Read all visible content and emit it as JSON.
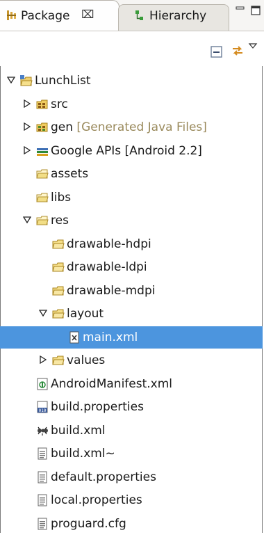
{
  "tabs": [
    {
      "label": "Package",
      "close": "⌧",
      "active": true
    },
    {
      "label": "Hierarchy",
      "active": false
    }
  ],
  "toolbar": {
    "collapse_icon": "collapse-all-icon",
    "link_icon": "link-with-editor-icon",
    "menu_icon": "view-menu-icon"
  },
  "tree": [
    {
      "label": "LunchList",
      "decoration": "",
      "indent": 0,
      "twisty": "expanded",
      "icon": "android-project-icon"
    },
    {
      "label": "src",
      "decoration": "",
      "indent": 1,
      "twisty": "collapsed",
      "icon": "source-folder-icon"
    },
    {
      "label": "gen",
      "decoration": " [Generated Java Files]",
      "indent": 1,
      "twisty": "collapsed",
      "icon": "gen-folder-icon"
    },
    {
      "label": "Google APIs [Android 2.2]",
      "decoration": "",
      "indent": 1,
      "twisty": "collapsed",
      "icon": "library-icon"
    },
    {
      "label": "assets",
      "decoration": "",
      "indent": 1,
      "twisty": "none",
      "icon": "project-folder-icon"
    },
    {
      "label": "libs",
      "decoration": "",
      "indent": 1,
      "twisty": "none",
      "icon": "project-folder-icon"
    },
    {
      "label": "res",
      "decoration": "",
      "indent": 1,
      "twisty": "expanded",
      "icon": "project-folder-icon"
    },
    {
      "label": "drawable-hdpi",
      "decoration": "",
      "indent": 2,
      "twisty": "none",
      "icon": "folder-icon"
    },
    {
      "label": "drawable-ldpi",
      "decoration": "",
      "indent": 2,
      "twisty": "none",
      "icon": "folder-icon"
    },
    {
      "label": "drawable-mdpi",
      "decoration": "",
      "indent": 2,
      "twisty": "none",
      "icon": "folder-icon"
    },
    {
      "label": "layout",
      "decoration": "",
      "indent": 2,
      "twisty": "expanded",
      "icon": "folder-icon"
    },
    {
      "label": "main.xml",
      "decoration": "",
      "indent": 3,
      "twisty": "none",
      "icon": "xml-file-icon",
      "selected": true
    },
    {
      "label": "values",
      "decoration": "",
      "indent": 2,
      "twisty": "collapsed",
      "icon": "folder-icon"
    },
    {
      "label": "AndroidManifest.xml",
      "decoration": "",
      "indent": 1,
      "twisty": "none",
      "icon": "manifest-icon"
    },
    {
      "label": "build.properties",
      "decoration": "",
      "indent": 1,
      "twisty": "none",
      "icon": "properties-file-icon"
    },
    {
      "label": "build.xml",
      "decoration": "",
      "indent": 1,
      "twisty": "none",
      "icon": "ant-icon"
    },
    {
      "label": "build.xml~",
      "decoration": "",
      "indent": 1,
      "twisty": "none",
      "icon": "text-file-icon"
    },
    {
      "label": "default.properties",
      "decoration": "",
      "indent": 1,
      "twisty": "none",
      "icon": "text-file-icon"
    },
    {
      "label": "local.properties",
      "decoration": "",
      "indent": 1,
      "twisty": "none",
      "icon": "text-file-icon"
    },
    {
      "label": "proguard.cfg",
      "decoration": "",
      "indent": 1,
      "twisty": "none",
      "icon": "text-file-icon"
    }
  ]
}
